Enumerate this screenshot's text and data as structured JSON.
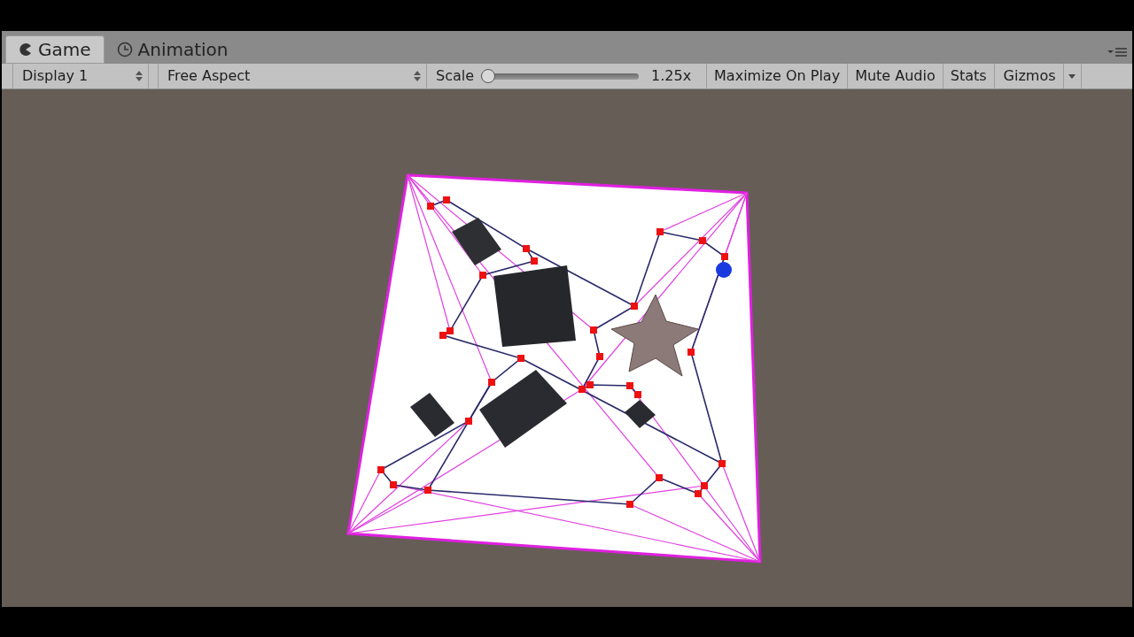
{
  "tabs": [
    {
      "label": "Game",
      "selected": true
    },
    {
      "label": "Animation",
      "selected": false
    }
  ],
  "toolbar": {
    "display": "Display 1",
    "aspect": "Free Aspect",
    "scale": {
      "label": "Scale",
      "level": 0.0,
      "reading": "1.25x"
    },
    "buttons": [
      "Maximize On Play",
      "Mute Audio",
      "Stats"
    ],
    "gizmos": "Gizmos"
  }
}
